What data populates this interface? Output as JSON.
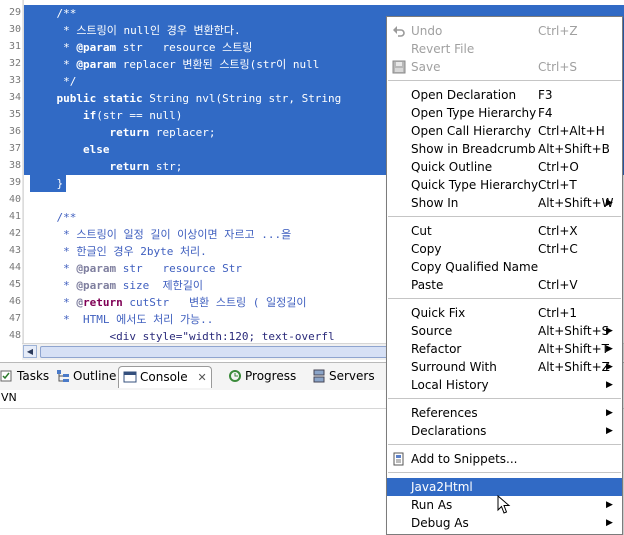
{
  "editor": {
    "line_numbers": [
      "29",
      "30",
      "31",
      "32",
      "33",
      "34",
      "35",
      "36",
      "37",
      "38",
      "39",
      "40",
      "41",
      "42",
      "43",
      "44",
      "45",
      "46",
      "47",
      "48"
    ],
    "lines": [
      {
        "text": "    /**",
        "selected": true
      },
      {
        "text": "     * 스트링이 null인 경우 변환한다.",
        "selected": true
      },
      {
        "text": "     * @param str   resource 스트링",
        "selected": true
      },
      {
        "text": "     * @param replacer 변환된 스트링(str이 null",
        "selected": true
      },
      {
        "text": "     */",
        "selected": true
      },
      {
        "text": "    public static String nvl(String str, String",
        "selected": true
      },
      {
        "text": "        if(str == null)",
        "selected": true
      },
      {
        "text": "            return replacer;",
        "selected": true
      },
      {
        "text": "        else",
        "selected": true
      },
      {
        "text": "            return str;",
        "selected": true
      },
      {
        "text": "    }",
        "selected": "partial"
      },
      {
        "text": "",
        "selected": false
      },
      {
        "text": "    /**",
        "selected": false
      },
      {
        "text": "     * 스트링이 일정 길이 이상이면 자르고 ...을",
        "selected": false
      },
      {
        "text": "     * 한글인 경우 2byte 처리.",
        "selected": false
      },
      {
        "text": "     * @param str   resource Str",
        "selected": false
      },
      {
        "text": "     * @param size  제한길이",
        "selected": false
      },
      {
        "text": "     * @return cutStr   변환 스트링 ( 일정길이",
        "selected": false
      },
      {
        "text": "     *  HTML 에서도 처리 가능..",
        "selected": false
      },
      {
        "text": "            <div style=\"width:120; text-overfl",
        "selected": false
      }
    ]
  },
  "views": {
    "tabs": [
      {
        "label": "Tasks",
        "icon": "tasks-icon"
      },
      {
        "label": "Outline",
        "icon": "outline-icon"
      },
      {
        "label": "Console",
        "icon": "console-icon",
        "active": true
      },
      {
        "label": "Progress",
        "icon": "progress-icon"
      },
      {
        "label": "Servers",
        "icon": "servers-icon"
      }
    ],
    "console_text": "VN"
  },
  "menu": {
    "items": [
      {
        "label": "Undo",
        "accel": "Ctrl+Z",
        "disabled": true,
        "icon": "undo-icon"
      },
      {
        "label": "Revert File",
        "disabled": true
      },
      {
        "label": "Save",
        "accel": "Ctrl+S",
        "disabled": true,
        "icon": "save-icon"
      },
      {
        "separator": true
      },
      {
        "label": "Open Declaration",
        "accel": "F3"
      },
      {
        "label": "Open Type Hierarchy",
        "accel": "F4"
      },
      {
        "label": "Open Call Hierarchy",
        "accel": "Ctrl+Alt+H"
      },
      {
        "label": "Show in Breadcrumb",
        "accel": "Alt+Shift+B"
      },
      {
        "label": "Quick Outline",
        "accel": "Ctrl+O"
      },
      {
        "label": "Quick Type Hierarchy",
        "accel": "Ctrl+T"
      },
      {
        "label": "Show In",
        "accel": "Alt+Shift+W",
        "submenu": true
      },
      {
        "separator": true
      },
      {
        "label": "Cut",
        "accel": "Ctrl+X"
      },
      {
        "label": "Copy",
        "accel": "Ctrl+C"
      },
      {
        "label": "Copy Qualified Name"
      },
      {
        "label": "Paste",
        "accel": "Ctrl+V"
      },
      {
        "separator": true
      },
      {
        "label": "Quick Fix",
        "accel": "Ctrl+1"
      },
      {
        "label": "Source",
        "accel": "Alt+Shift+S",
        "submenu": true
      },
      {
        "label": "Refactor",
        "accel": "Alt+Shift+T",
        "submenu": true
      },
      {
        "label": "Surround With",
        "accel": "Alt+Shift+Z",
        "submenu": true
      },
      {
        "label": "Local History",
        "submenu": true
      },
      {
        "separator": true
      },
      {
        "label": "References",
        "submenu": true
      },
      {
        "label": "Declarations",
        "submenu": true
      },
      {
        "separator": true
      },
      {
        "label": "Add to Snippets...",
        "icon": "snippet-icon"
      },
      {
        "separator": true
      },
      {
        "label": "Java2Html",
        "highlighted": true
      },
      {
        "label": "Run As",
        "submenu": true
      },
      {
        "label": "Debug As",
        "submenu": true
      }
    ],
    "highlight_color": "#316ac5"
  }
}
